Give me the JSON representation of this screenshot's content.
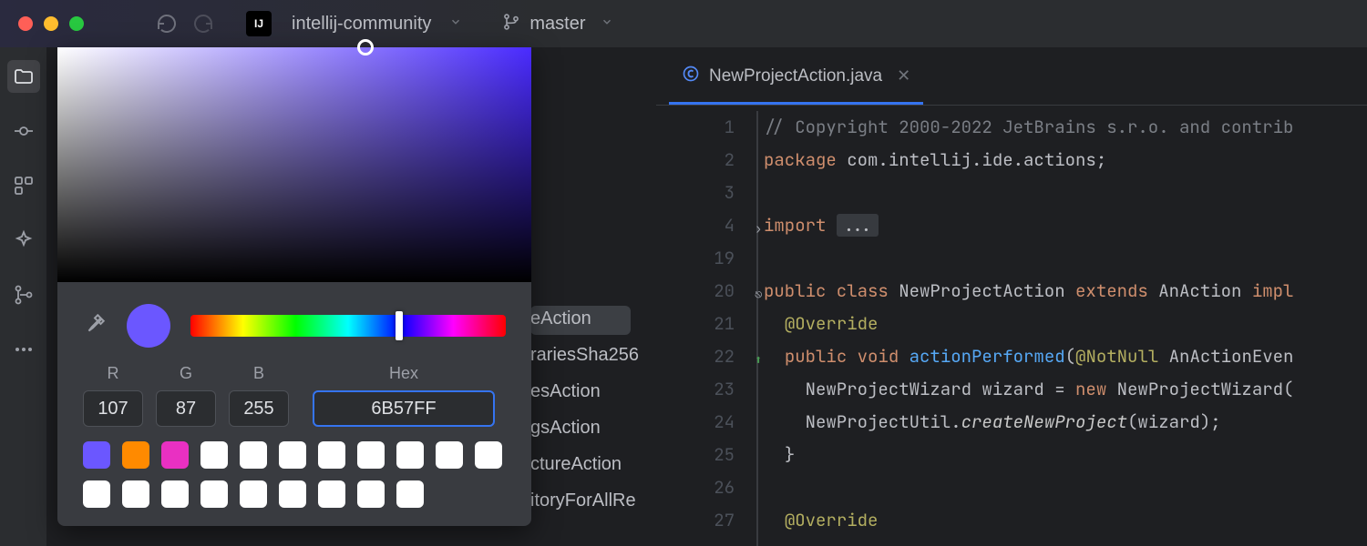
{
  "titlebar": {
    "project": "intellij-community",
    "branch": "master"
  },
  "colorPicker": {
    "r_label": "R",
    "g_label": "G",
    "b_label": "B",
    "hex_label": "Hex",
    "r": "107",
    "g": "87",
    "b": "255",
    "hex": "6B57FF",
    "preview": "#6b57ff",
    "swatches_row1": [
      "#6b57ff",
      "#ff8a00",
      "#e930c2",
      "#ffffff",
      "#ffffff",
      "#ffffff",
      "#ffffff",
      "#ffffff",
      "#ffffff",
      "#ffffff"
    ],
    "swatches_row2": [
      "#ffffff",
      "#ffffff",
      "#ffffff",
      "#ffffff",
      "#ffffff",
      "#ffffff",
      "#ffffff",
      "#ffffff",
      "#ffffff",
      "#ffffff"
    ]
  },
  "peekList": {
    "items": [
      "eAction",
      "rariesSha256",
      "esAction",
      "gsAction",
      "ctureAction",
      "itoryForAllRe"
    ]
  },
  "editor": {
    "tab": {
      "name": "NewProjectAction.java"
    },
    "gutter": [
      "1",
      "2",
      "3",
      "4",
      "19",
      "20",
      "21",
      "22",
      "23",
      "24",
      "25",
      "26",
      "27"
    ],
    "code": {
      "l1_cmt": "// Copyright 2000-2022 JetBrains s.r.o. and contrib",
      "l2_kw": "package",
      "l2_rest": " com.intellij.ide.actions;",
      "l4_kw": "import ",
      "l4_fold": "...",
      "l20_a": "public class ",
      "l20_b": "NewProjectAction ",
      "l20_c": "extends ",
      "l20_d": "AnAction ",
      "l20_e": "impl",
      "l21_ann": "@Override",
      "l22_a": "public void ",
      "l22_b": "actionPerformed",
      "l22_c": "(",
      "l22_d": "@NotNull ",
      "l22_e": "AnActionEven",
      "l23_a": "NewProjectWizard wizard = ",
      "l23_b": "new ",
      "l23_c": "NewProjectWizard(",
      "l24_a": "NewProjectUtil.",
      "l24_b": "createNewProject",
      "l24_c": "(wizard);",
      "l25": "}",
      "l27_ann": "@Override"
    }
  }
}
